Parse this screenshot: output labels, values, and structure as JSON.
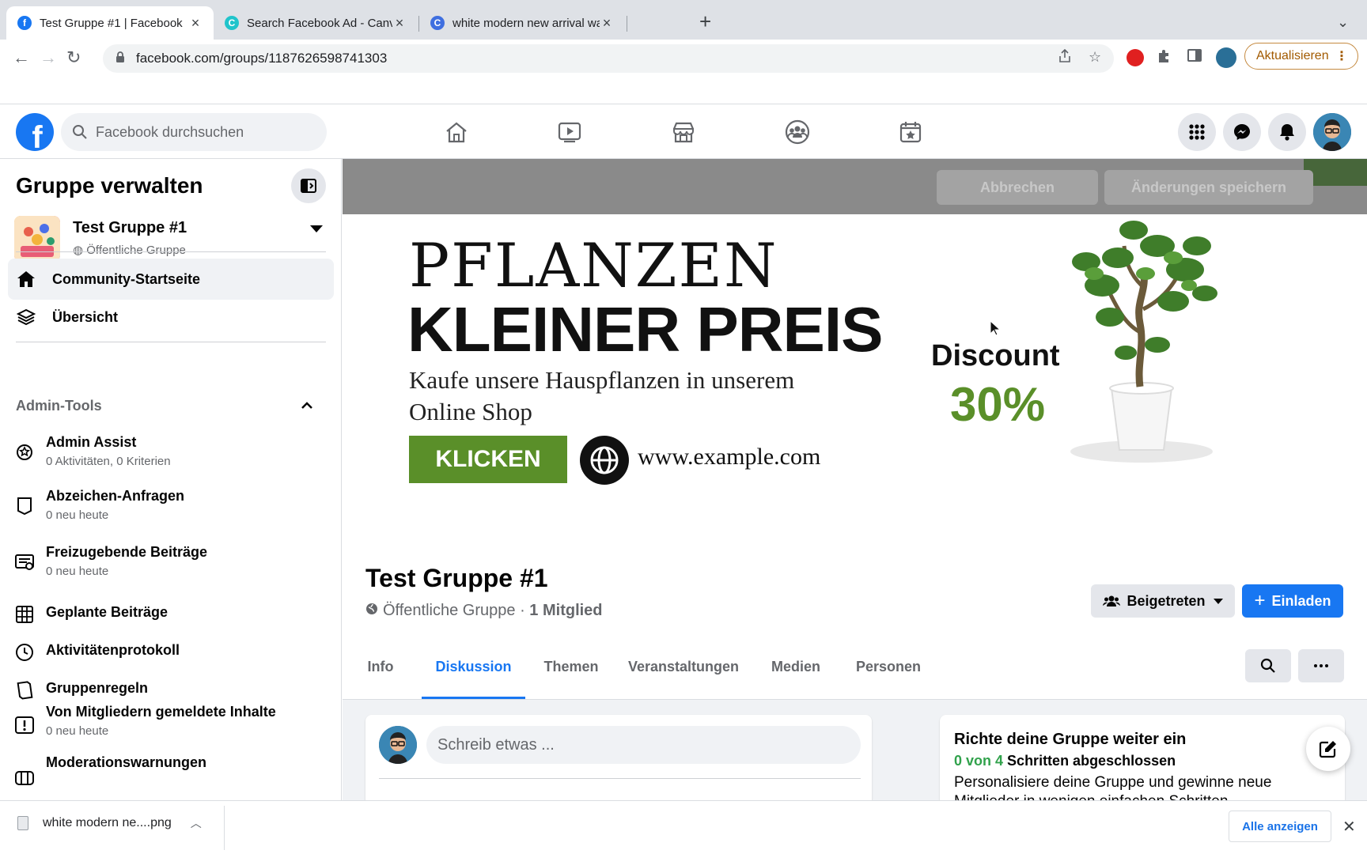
{
  "browser": {
    "tabs": [
      {
        "title": "Test Gruppe #1 | Facebook",
        "active": true
      },
      {
        "title": "Search Facebook Ad - Canva",
        "active": false
      },
      {
        "title": "white modern new arrival watc",
        "active": false
      }
    ],
    "url": "facebook.com/groups/1187626598741303",
    "update_label": "Aktualisieren"
  },
  "header": {
    "logo": "f",
    "search_placeholder": "Facebook durchsuchen",
    "nav_icons": [
      "home-icon",
      "watch-icon",
      "marketplace-icon",
      "groups-icon",
      "gaming-icon"
    ],
    "action_icons": [
      "menu-grid-icon",
      "messenger-icon",
      "notifications-icon"
    ]
  },
  "sidebar": {
    "title": "Gruppe verwalten",
    "group": {
      "name": "Test Gruppe #1",
      "privacy": "Öffentliche Gruppe"
    },
    "nav": [
      {
        "label": "Community-Startseite",
        "icon": "home-icon",
        "active": true
      },
      {
        "label": "Übersicht",
        "icon": "layers-icon",
        "active": false
      }
    ],
    "admin_section": "Admin-Tools",
    "tools": [
      {
        "label": "Admin Assist",
        "sub": "0 Aktivitäten, 0 Kriterien",
        "icon": "admin-assist-icon"
      },
      {
        "label": "Abzeichen-Anfragen",
        "sub": "0 neu heute",
        "icon": "badge-icon"
      },
      {
        "label": "Freizugebende Beiträge",
        "sub": "0 neu heute",
        "icon": "pending-posts-icon"
      },
      {
        "label": "Geplante Beiträge",
        "sub": "",
        "icon": "calendar-icon"
      },
      {
        "label": "Aktivitätenprotokoll",
        "sub": "",
        "icon": "clock-icon"
      },
      {
        "label": "Gruppenregeln",
        "sub": "",
        "icon": "rules-icon"
      },
      {
        "label": "Von Mitgliedern gemeldete Inhalte",
        "sub": "0 neu heute",
        "icon": "report-icon"
      },
      {
        "label": "Moderationswarnungen",
        "sub": "",
        "icon": "warning-icon"
      }
    ]
  },
  "edit_bar": {
    "cancel": "Abbrechen",
    "save": "Änderungen speichern"
  },
  "cover": {
    "headline1": "PFLANZEN",
    "headline2": "KLEINER PREIS",
    "line1": "Kaufe unsere Hauspflanzen in unserem",
    "line2": "Online Shop",
    "button": "KLICKEN",
    "url": "www.example.com",
    "discount_label": "Discount",
    "discount_value": "30%",
    "colors": {
      "accent_green": "#5a8f29"
    }
  },
  "group": {
    "title": "Test Gruppe #1",
    "privacy": "Öffentliche Gruppe",
    "separator": " · ",
    "members": "1 Mitglied",
    "joined_label": "Beigetreten",
    "invite_label": "Einladen"
  },
  "tabs": [
    {
      "label": "Info",
      "active": false
    },
    {
      "label": "Diskussion",
      "active": true
    },
    {
      "label": "Themen",
      "active": false
    },
    {
      "label": "Veranstaltungen",
      "active": false
    },
    {
      "label": "Medien",
      "active": false
    },
    {
      "label": "Personen",
      "active": false
    }
  ],
  "composer": {
    "placeholder": "Schreib etwas ..."
  },
  "setup_card": {
    "title": "Richte deine Gruppe weiter ein",
    "progress_done": "0 von 4",
    "progress_rest": "Schritten abgeschlossen",
    "description": "Personalisiere deine Gruppe und gewinne neue Mitglieder in wenigen einfachen Schritten."
  },
  "downloads": {
    "file": "white modern ne....png",
    "show_all": "Alle anzeigen"
  },
  "colors": {
    "fb_blue": "#1877f2",
    "bg_gray": "#f0f2f5",
    "progress_green": "#31a24c"
  }
}
